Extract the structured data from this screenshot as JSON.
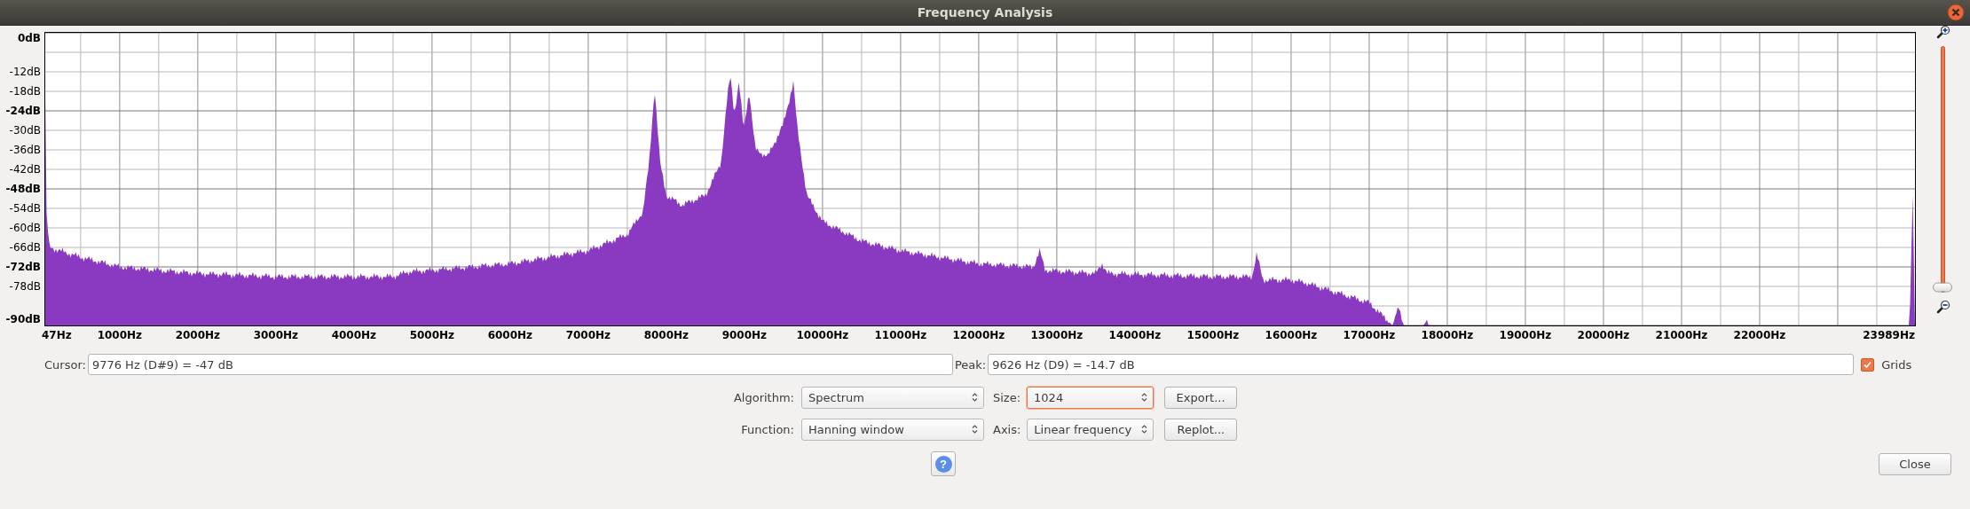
{
  "window": {
    "title": "Frequency Analysis"
  },
  "plot": {
    "y_ticks": [
      {
        "label": "0dB",
        "major": true
      },
      {
        "label": "-12dB",
        "major": false
      },
      {
        "label": "-18dB",
        "major": false
      },
      {
        "label": "-24dB",
        "major": true
      },
      {
        "label": "-30dB",
        "major": false
      },
      {
        "label": "-36dB",
        "major": false
      },
      {
        "label": "-42dB",
        "major": false
      },
      {
        "label": "-48dB",
        "major": true
      },
      {
        "label": "-54dB",
        "major": false
      },
      {
        "label": "-60dB",
        "major": false
      },
      {
        "label": "-66dB",
        "major": false
      },
      {
        "label": "-72dB",
        "major": true
      },
      {
        "label": "-78dB",
        "major": false
      },
      {
        "label": "-90dB",
        "major": true
      }
    ],
    "x_ticks": [
      "47Hz",
      "1000Hz",
      "2000Hz",
      "3000Hz",
      "4000Hz",
      "5000Hz",
      "6000Hz",
      "7000Hz",
      "8000Hz",
      "9000Hz",
      "10000Hz",
      "11000Hz",
      "12000Hz",
      "13000Hz",
      "14000Hz",
      "15000Hz",
      "16000Hz",
      "17000Hz",
      "18000Hz",
      "19000Hz",
      "20000Hz",
      "21000Hz",
      "22000Hz",
      "23989Hz"
    ],
    "grids_shown": true,
    "zoom_slider": {
      "level": 1
    }
  },
  "cursor": {
    "label": "Cursor:",
    "value": "9776 Hz (D#9) = -47 dB"
  },
  "peak": {
    "label": "Peak:",
    "value": "9626 Hz (D9) = -14.7 dB"
  },
  "grids": {
    "label": "Grids",
    "checked": true
  },
  "controls": [
    {
      "label": "Algorithm:",
      "value": "Spectrum",
      "focused": false,
      "side_label": "Size:",
      "side_value": "1024",
      "side_focused": true,
      "button": "Export..."
    },
    {
      "label": "Function:",
      "value": "Hanning window",
      "focused": false,
      "side_label": "Axis:",
      "side_value": "Linear frequency",
      "side_focused": false,
      "button": "Replot..."
    }
  ],
  "help": "?",
  "close": "Close"
}
